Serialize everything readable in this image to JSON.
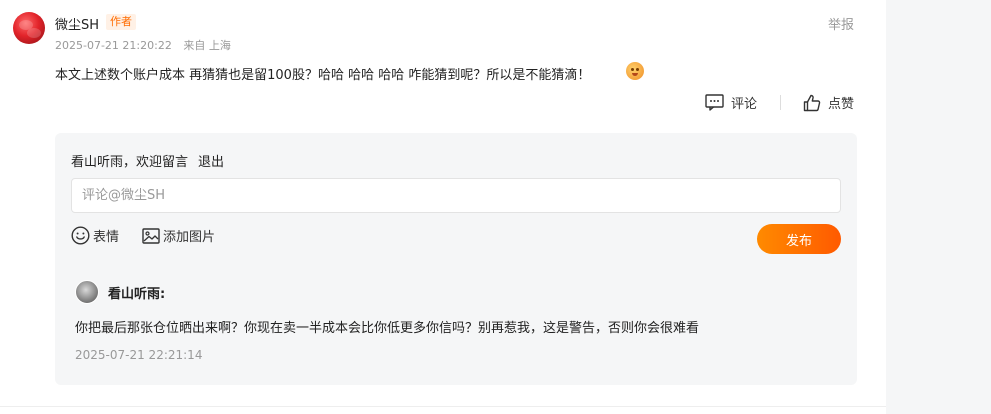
{
  "comment": {
    "username": "微尘SH",
    "author_badge": "作者",
    "timestamp": "2025-07-21 21:20:22",
    "location": "来自 上海",
    "report_label": "举报",
    "text": "本文上述数个账户成本 再猜猜也是留100股？哈哈 哈哈 哈哈 咋能猜到呢？所以是不能猜滴！",
    "emoji_icon": "blushing-face-icon",
    "actions": {
      "comment_label": "评论",
      "like_label": "点赞"
    }
  },
  "reply_box": {
    "greeting": "看山听雨，欢迎留言",
    "logout_label": "退出",
    "input_placeholder": "评论@微尘SH",
    "input_value": "",
    "emoji_label": "表情",
    "image_label": "添加图片",
    "publish_label": "发布"
  },
  "reply": {
    "name": "看山听雨:",
    "text": "你把最后那张仓位晒出来啊？你现在卖一半成本会比你低更多你信吗？别再惹我，这是警告，否则你会很难看",
    "timestamp": "2025-07-21 22:21:14"
  },
  "colors": {
    "accent": "#ff6c00",
    "badge_bg": "#fff1e6",
    "panel_bg": "#f5f6f7",
    "muted_text": "#999999",
    "publish_gradient_start": "#ff8a00",
    "publish_gradient_end": "#ff5a00"
  }
}
